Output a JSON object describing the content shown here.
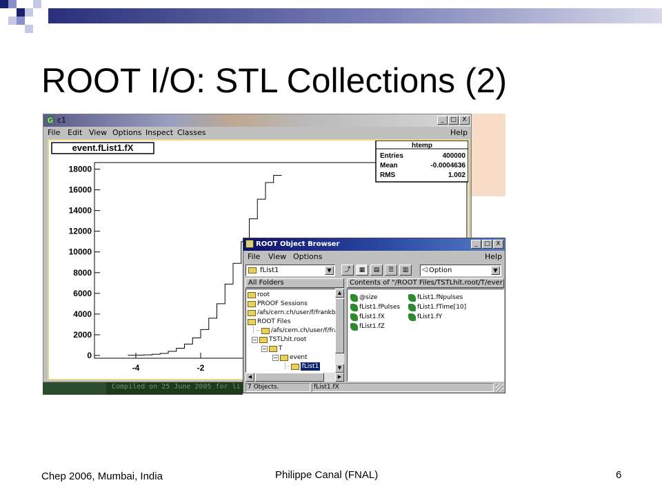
{
  "slide": {
    "title": "ROOT I/O: STL Collections (2)",
    "footer_left": "Chep 2006, Mumbai, India",
    "footer_center": "Philippe Canal (FNAL)",
    "page_number": "6"
  },
  "canvas_window": {
    "title": "c1",
    "menu": [
      "File",
      "Edit",
      "View",
      "Options",
      "Inspect",
      "Classes",
      "Help"
    ],
    "window_buttons": [
      "_",
      "□",
      "X"
    ],
    "plot_title": "event.fList1.fX",
    "stats": {
      "name": "htemp",
      "rows": [
        {
          "label": "Entries",
          "value": "400000"
        },
        {
          "label": "Mean",
          "value": "-0.0004636"
        },
        {
          "label": "RMS",
          "value": "1.002"
        }
      ]
    },
    "background_text": "Compiled on 25 June 2005 for li"
  },
  "chart_data": {
    "type": "bar",
    "title": "event.fList1.fX",
    "x_ticks": [
      "-4",
      "-2"
    ],
    "y_ticks": [
      "0",
      "2000",
      "4000",
      "6000",
      "8000",
      "10000",
      "12000",
      "14000",
      "16000",
      "18000"
    ],
    "ylim": [
      0,
      18500
    ],
    "x": [
      -4.25,
      -4.0,
      -3.75,
      -3.5,
      -3.25,
      -3.0,
      -2.75,
      -2.5,
      -2.25,
      -2.0,
      -1.75,
      -1.5,
      -1.25,
      -1.0,
      -0.75,
      -0.5,
      -0.25,
      0.0,
      0.25
    ],
    "values": [
      20,
      30,
      60,
      120,
      200,
      400,
      700,
      1100,
      1700,
      2500,
      3600,
      5000,
      6900,
      8900,
      11000,
      13200,
      15100,
      16700,
      17400
    ]
  },
  "browser_window": {
    "title": "ROOT Object Browser",
    "menu": [
      "File",
      "View",
      "Options",
      "Help"
    ],
    "window_buttons": [
      "_",
      "□",
      "X"
    ],
    "location_combo": "fList1",
    "option_combo": "Option",
    "left_header": "All Folders",
    "right_header": "Contents of \"/ROOT Files/TSTLhit.root/T/ever",
    "tree": [
      {
        "label": "root",
        "level": 0
      },
      {
        "label": "PROOF Sessions",
        "level": 0
      },
      {
        "label": "/afs/cern.ch/user/f/frankb/sc",
        "level": 0
      },
      {
        "label": "ROOT Files",
        "level": 0
      },
      {
        "label": "/afs/cern.ch/user/f/frankb",
        "level": 1
      },
      {
        "label": "TSTLhit.root",
        "level": 1
      },
      {
        "label": "T",
        "level": 2
      },
      {
        "label": "event",
        "level": 3
      },
      {
        "label": "fList1",
        "level": 4,
        "selected": true
      }
    ],
    "contents_col1": [
      "@size",
      "fList1.fPulses",
      "fList1.fX",
      "fList1.fZ"
    ],
    "contents_col2": [
      "fList1.fNpulses",
      "fList1.fTime[10]",
      "fList1.fY"
    ],
    "status_left": "7 Objects.",
    "status_right": "fList1.fX"
  }
}
